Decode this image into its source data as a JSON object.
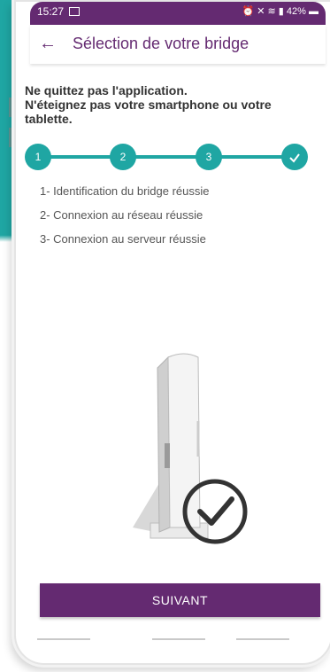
{
  "status_bar": {
    "time": "15:27",
    "battery": "42%"
  },
  "header": {
    "back_icon": "arrow-left-icon",
    "title": "Sélection de votre bridge"
  },
  "warning": {
    "line1": "Ne quittez pas l'application.",
    "line2": "N'éteignez pas votre smartphone ou votre tablette."
  },
  "stepper": {
    "steps": [
      "1",
      "2",
      "3"
    ],
    "done_icon": "check-icon",
    "color": "#1fa6a3"
  },
  "results": [
    "1- Identification du bridge réussie",
    "2- Connexion au réseau réussie",
    "3- Connexion au serveur réussie"
  ],
  "illustration": {
    "device_icon": "bridge-device-icon",
    "success_icon": "check-circle-icon"
  },
  "footer": {
    "next_label": "SUIVANT"
  },
  "colors": {
    "brand_purple": "#642a71",
    "teal": "#1fa6a3"
  }
}
